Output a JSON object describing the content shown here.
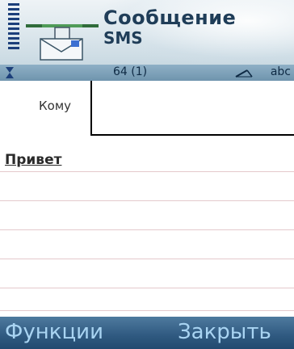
{
  "header": {
    "title": "Сообщение",
    "subtitle": "SMS",
    "icon": "message-envelope-icon"
  },
  "status_bar": {
    "counter": "64 (1)",
    "input_mode": "abc",
    "pen_icon": "pen-icon"
  },
  "compose": {
    "to_label": "Кому",
    "to_value": "",
    "message": "Привет"
  },
  "softkeys": {
    "left": "Функции",
    "right": "Закрыть"
  },
  "colors": {
    "title": "#1f3d58",
    "softkey_bar": "#2f5980",
    "softkey_text": "#a9d4f2",
    "status_bar": "#7fa2ba"
  }
}
